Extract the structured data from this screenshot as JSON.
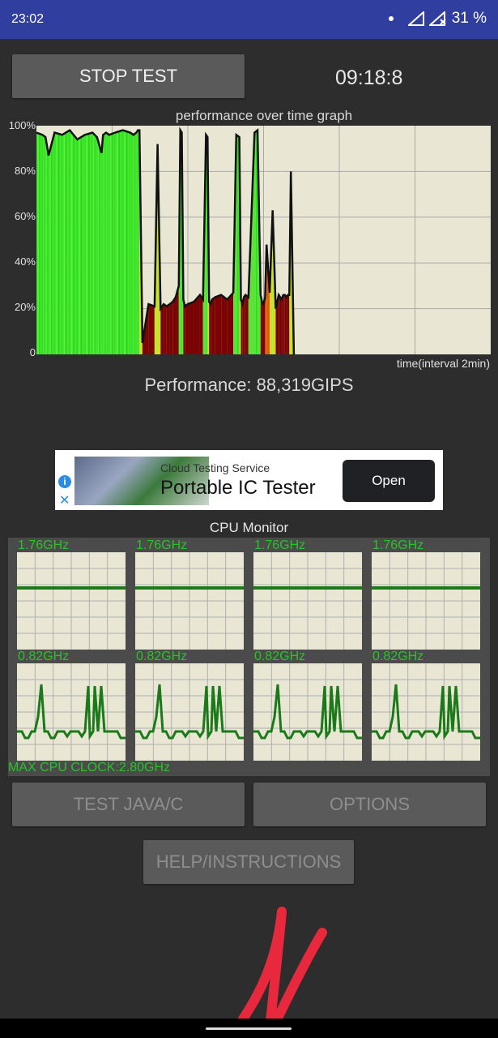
{
  "status": {
    "time": "23:02",
    "battery": "31 %"
  },
  "controls": {
    "stop_label": "STOP TEST",
    "timer": "09:18:8"
  },
  "graph": {
    "title": "performance over time graph",
    "y_labels": [
      "100%",
      "80%",
      "60%",
      "40%",
      "20%",
      "0"
    ],
    "x_label": "time(interval 2min)"
  },
  "chart_data": {
    "type": "area",
    "title": "performance over time graph",
    "xlabel": "time(interval 2min)",
    "ylabel": "",
    "ylim": [
      0,
      100
    ],
    "x": [
      0,
      4,
      6,
      8,
      12,
      17,
      22,
      27,
      32,
      37,
      40,
      43,
      44,
      46,
      48,
      52,
      57,
      62,
      64,
      66,
      67,
      68,
      70,
      74,
      78,
      80,
      82,
      84,
      86,
      88,
      90,
      92,
      94,
      95,
      96,
      97,
      98,
      100,
      104,
      108,
      110,
      112,
      113,
      114,
      115,
      116,
      118,
      122,
      126,
      130,
      132,
      134,
      135,
      136,
      137,
      138,
      140,
      144,
      146,
      148,
      149,
      150,
      151,
      152,
      154,
      156,
      158,
      160,
      162,
      163,
      164,
      165,
      166,
      167,
      168,
      170,
      172,
      174,
      175,
      176,
      177,
      178,
      180,
      182,
      184,
      186,
      188,
      190,
      191,
      192
    ],
    "y": [
      97,
      96,
      95,
      87,
      97,
      96,
      98,
      94,
      96,
      97,
      95,
      88,
      96,
      97,
      96,
      97,
      98,
      97,
      96,
      97,
      98,
      98,
      5,
      22,
      21,
      92,
      20,
      22,
      21,
      22,
      23,
      25,
      30,
      98,
      97,
      24,
      21,
      22,
      23,
      26,
      24,
      96,
      95,
      23,
      22,
      24,
      25,
      26,
      24,
      27,
      96,
      95,
      24,
      22,
      25,
      26,
      25,
      97,
      98,
      26,
      23,
      22,
      25,
      48,
      27,
      63,
      20,
      26,
      24,
      26,
      26,
      25,
      26,
      26,
      80,
      0,
      0,
      0,
      0,
      0,
      0,
      0,
      0,
      0,
      0,
      0,
      0,
      0,
      0,
      0
    ],
    "fill_note": "green above ~50%, dark red below",
    "grid": true
  },
  "performance_text": "Performance: 88,319GIPS",
  "ad": {
    "small": "Cloud Testing Service",
    "big": "Portable IC Tester",
    "open_label": "Open"
  },
  "cpu": {
    "title": "CPU Monitor",
    "top_labels": [
      "1.76GHz",
      "1.76GHz",
      "1.76GHz",
      "1.76GHz"
    ],
    "bottom_labels": [
      "0.82GHz",
      "0.82GHz",
      "0.82GHz",
      "0.82GHz"
    ],
    "max_clock": "MAX CPU CLOCK:2.80GHz"
  },
  "buttons": {
    "test_java": "TEST JAVA/C",
    "options": "OPTIONS",
    "help": "HELP/INSTRUCTIONS"
  }
}
